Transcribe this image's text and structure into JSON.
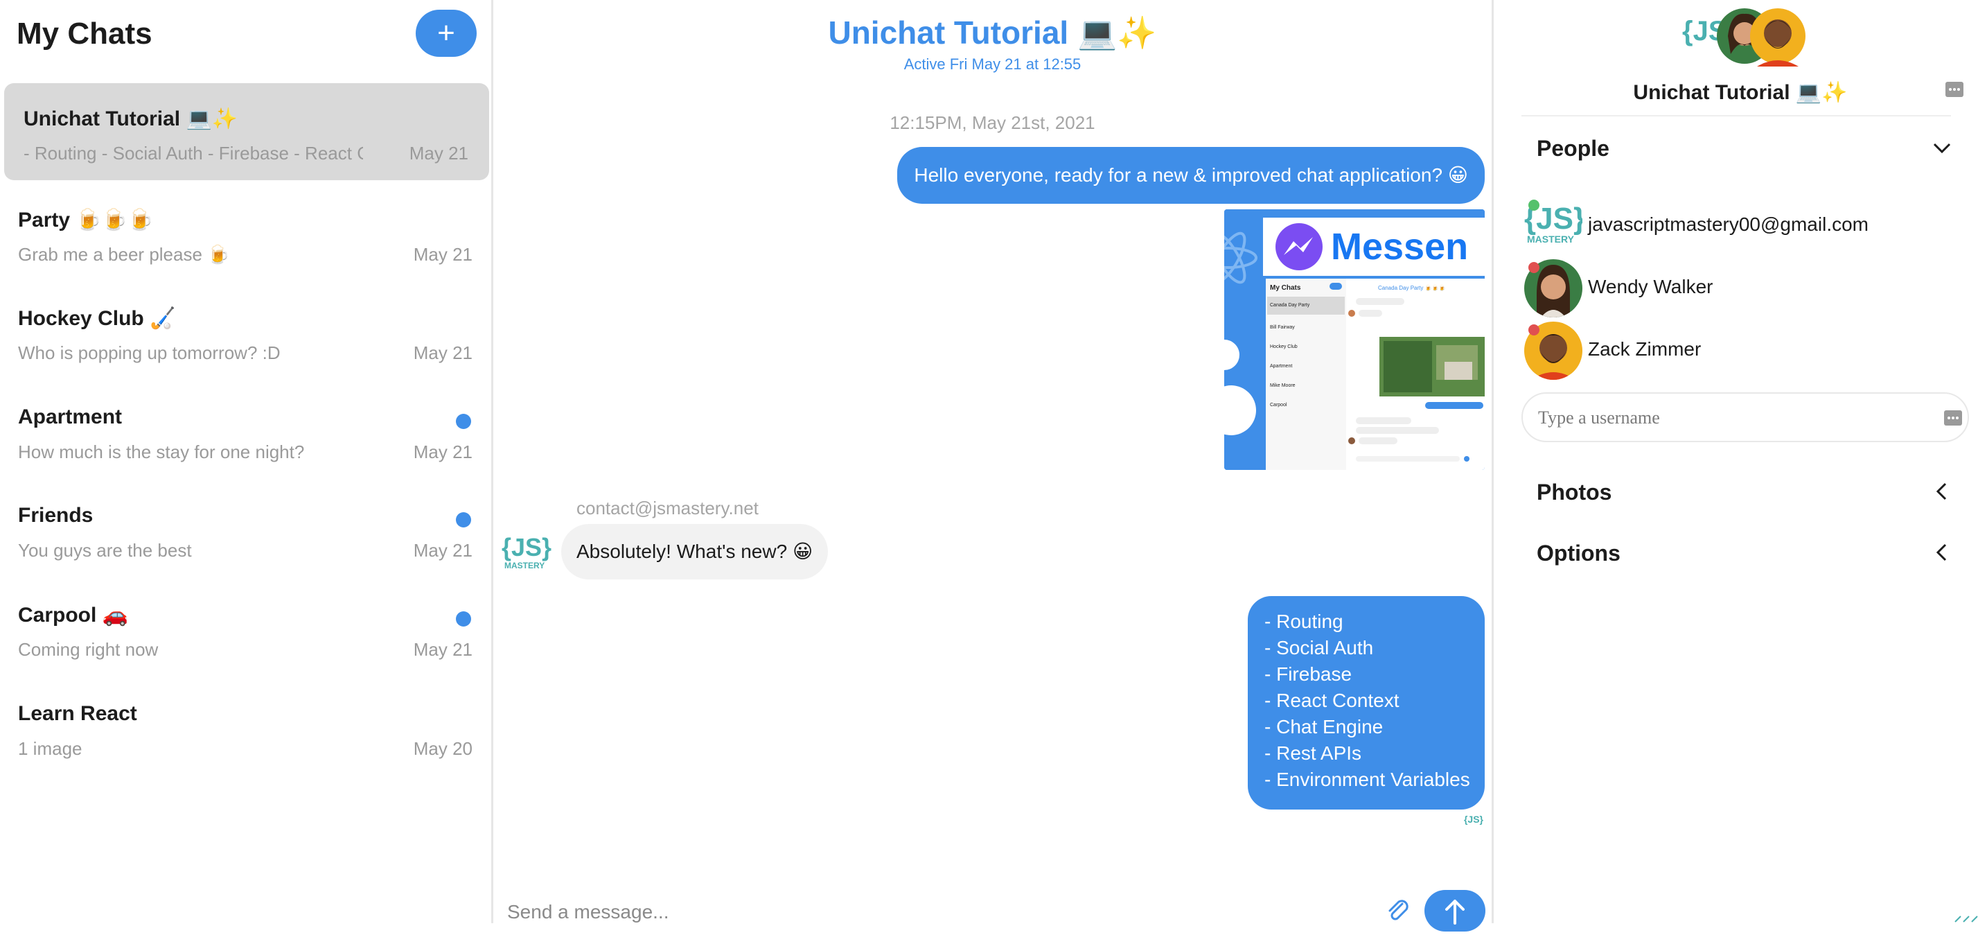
{
  "colors": {
    "accent": "#3f8ee8",
    "selected_card": "#d9d9d9",
    "muted_text": "#9a9a9a",
    "other_bubble": "#f2f2f2"
  },
  "chat_list": {
    "title": "My Chats",
    "new_chat_label": "+",
    "chats": [
      {
        "title": "Unichat Tutorial 💻✨",
        "preview": "- Routing - Social Auth - Firebase - React Context",
        "date": "May 21",
        "selected": true,
        "unread": false
      },
      {
        "title": "Party 🍺🍺🍺",
        "preview": "Grab me a beer please 🍺",
        "date": "May 21",
        "selected": false,
        "unread": false
      },
      {
        "title": "Hockey Club 🏑",
        "preview": "Who is popping up tomorrow? :D",
        "date": "May 21",
        "selected": false,
        "unread": false
      },
      {
        "title": "Apartment",
        "preview": "How much is the stay for one night?",
        "date": "May 21",
        "selected": false,
        "unread": true
      },
      {
        "title": "Friends",
        "preview": "You guys are the best",
        "date": "May 21",
        "selected": false,
        "unread": true
      },
      {
        "title": "Carpool 🚗",
        "preview": "Coming right now",
        "date": "May 21",
        "selected": false,
        "unread": true
      },
      {
        "title": "Learn React",
        "preview": "1 image",
        "date": "May 20",
        "selected": false,
        "unread": false
      }
    ]
  },
  "feed": {
    "title": "Unichat Tutorial 💻✨",
    "subtitle": "Active Fri May 21 at 12:55",
    "date_divider": "12:15PM, May 21st, 2021",
    "messages": {
      "first": "Hello everyone, ready for a new & improved chat application? 😀",
      "image_text": "Messen",
      "image_mini_list": [
        "My Chats",
        "Canada Day Party",
        "Bill Fairway",
        "Hockey Club",
        "Apartment",
        "Mike Moore",
        "Carpool"
      ],
      "image_mini_header": "Canada Day Party 🍺🍺🍺",
      "their_sender": "contact@jsmastery.net",
      "their_text": "Absolutely! What's new? 😀",
      "list_lines": [
        "- Routing",
        "- Social Auth",
        "- Firebase",
        "- React Context",
        "- Chat Engine",
        "- Rest APIs",
        "- Environment Variables"
      ]
    },
    "input_placeholder": "Send a message..."
  },
  "brand": {
    "logo_text": "{JS}",
    "logo_subtext": "MASTERY"
  },
  "settings": {
    "title": "Unichat Tutorial 💻✨",
    "people_label": "People",
    "people": [
      {
        "name": "javascriptmastery00@gmail.com",
        "avatar": "js-logo",
        "presence": "#55c16b"
      },
      {
        "name": "Wendy Walker",
        "avatar": "person-woman",
        "presence": "#e05050"
      },
      {
        "name": "Zack Zimmer",
        "avatar": "person-man",
        "presence": "#e05050"
      }
    ],
    "username_placeholder": "Type a username",
    "photos_label": "Photos",
    "options_label": "Options"
  }
}
